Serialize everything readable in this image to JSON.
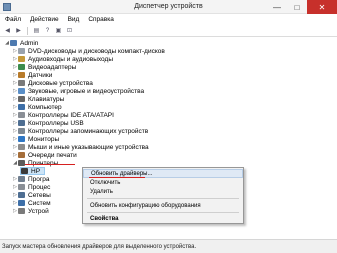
{
  "window": {
    "title": "Диспетчер устройств",
    "minimize": "—",
    "maximize": "□",
    "close": "✕"
  },
  "menu": [
    "Файл",
    "Действие",
    "Вид",
    "Справка"
  ],
  "toolbar": {
    "icons": [
      "back-arrow-icon",
      "forward-arrow-icon",
      "properties-icon",
      "help-icon",
      "update-driver-icon",
      "scan-hardware-icon"
    ]
  },
  "tree": {
    "root": "Admin",
    "categories": [
      "DVD-дисководы и дисководы компакт-дисков",
      "Аудиовходы и аудиовыходы",
      "Видеоадаптеры",
      "Датчики",
      "Дисковые устройства",
      "Звуковые, игровые и видеоустройства",
      "Клавиатуры",
      "Компьютер",
      "Контроллеры IDE ATA/ATAPI",
      "Контроллеры USB",
      "Контроллеры запоминающих устройств",
      "Мониторы",
      "Мыши и иные указывающие устройства",
      "Очереди печати",
      "Принтеры"
    ],
    "printer_child": "HP",
    "after_categories": [
      "Програ",
      "Процес",
      "Сетевы",
      "Систем",
      "Устрой"
    ]
  },
  "context_menu": {
    "items": [
      "Обновить драйверы...",
      "Отключить",
      "Удалить",
      "Обновить конфигурацию оборудования",
      "Свойства"
    ]
  },
  "status": {
    "text": "Запуск мастера обновления драйверов для выделенного устройства."
  }
}
